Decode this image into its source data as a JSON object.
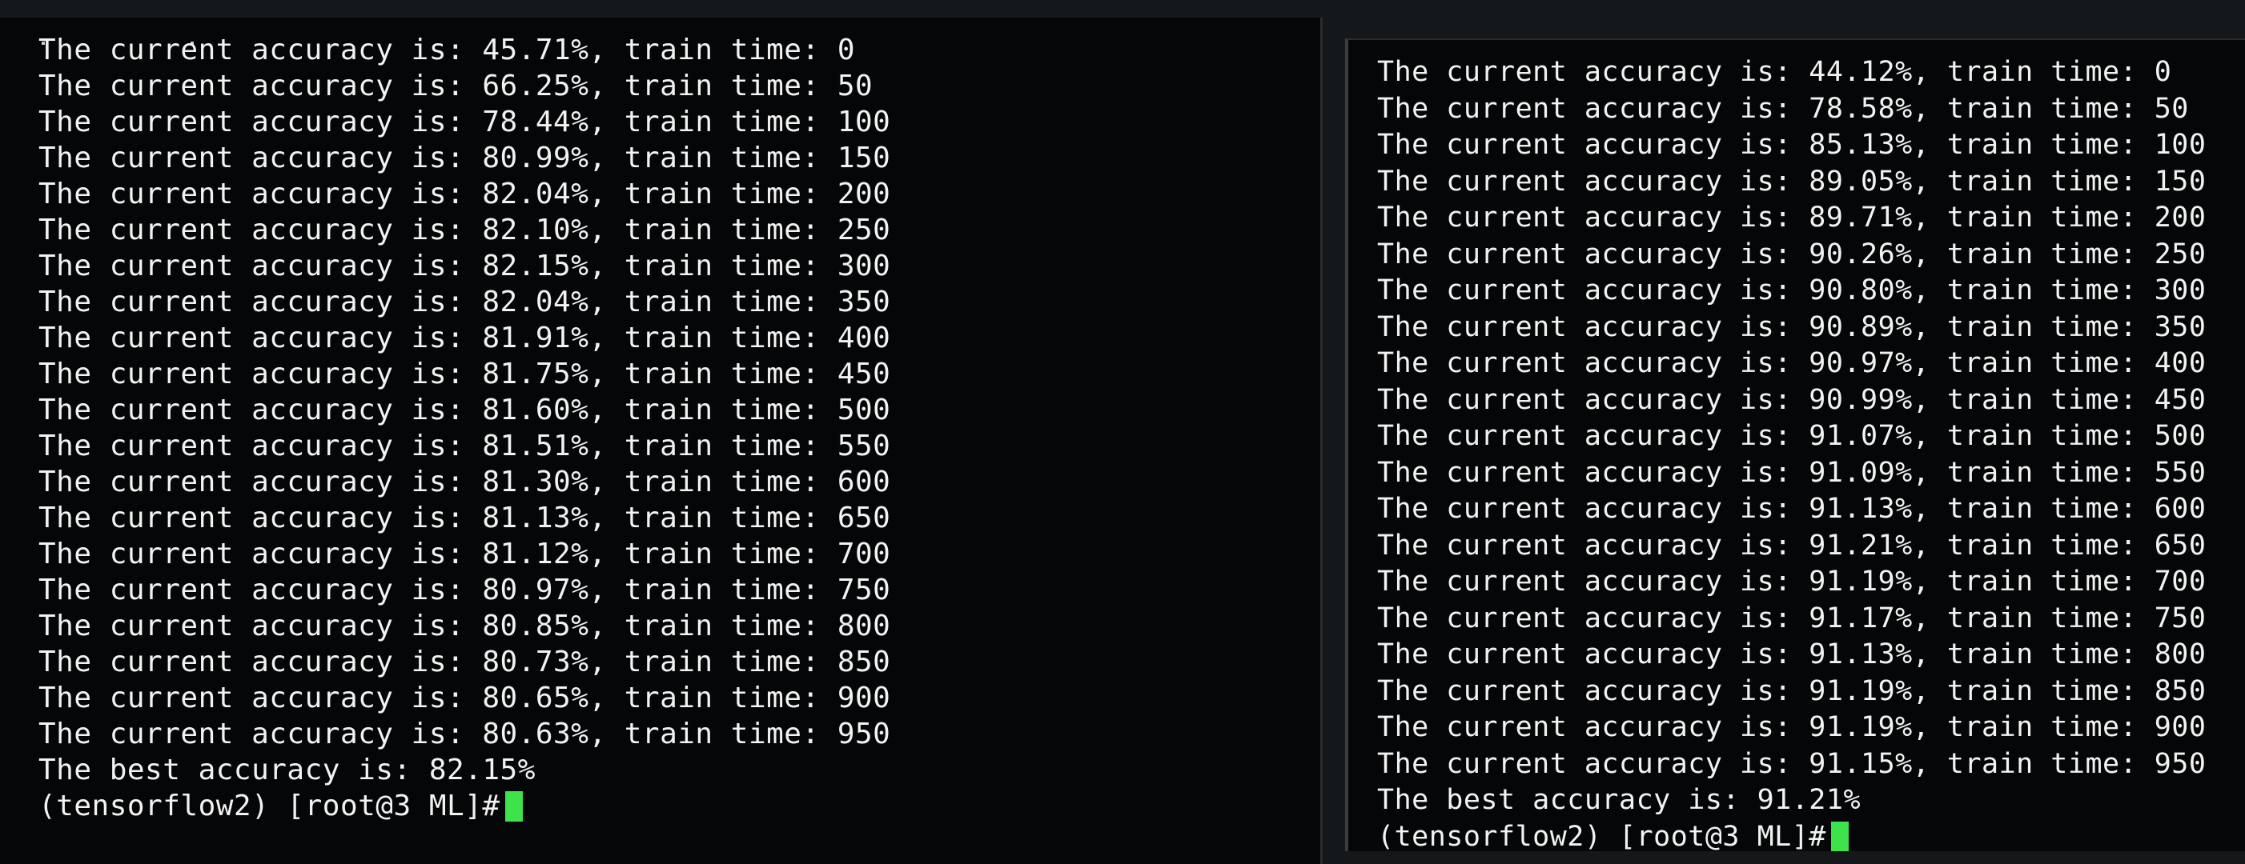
{
  "left_terminal": {
    "lines": [
      "The current accuracy is: 45.71%, train time: 0",
      "The current accuracy is: 66.25%, train time: 50",
      "The current accuracy is: 78.44%, train time: 100",
      "The current accuracy is: 80.99%, train time: 150",
      "The current accuracy is: 82.04%, train time: 200",
      "The current accuracy is: 82.10%, train time: 250",
      "The current accuracy is: 82.15%, train time: 300",
      "The current accuracy is: 82.04%, train time: 350",
      "The current accuracy is: 81.91%, train time: 400",
      "The current accuracy is: 81.75%, train time: 450",
      "The current accuracy is: 81.60%, train time: 500",
      "The current accuracy is: 81.51%, train time: 550",
      "The current accuracy is: 81.30%, train time: 600",
      "The current accuracy is: 81.13%, train time: 650",
      "The current accuracy is: 81.12%, train time: 700",
      "The current accuracy is: 80.97%, train time: 750",
      "The current accuracy is: 80.85%, train time: 800",
      "The current accuracy is: 80.73%, train time: 850",
      "The current accuracy is: 80.65%, train time: 900",
      "The current accuracy is: 80.63%, train time: 950",
      "The best accuracy is: 82.15%"
    ],
    "prompt": "(tensorflow2) [root@3 ML]#"
  },
  "right_terminal": {
    "lines": [
      "The current accuracy is: 44.12%, train time: 0",
      "The current accuracy is: 78.58%, train time: 50",
      "The current accuracy is: 85.13%, train time: 100",
      "The current accuracy is: 89.05%, train time: 150",
      "The current accuracy is: 89.71%, train time: 200",
      "The current accuracy is: 90.26%, train time: 250",
      "The current accuracy is: 90.80%, train time: 300",
      "The current accuracy is: 90.89%, train time: 350",
      "The current accuracy is: 90.97%, train time: 400",
      "The current accuracy is: 90.99%, train time: 450",
      "The current accuracy is: 91.07%, train time: 500",
      "The current accuracy is: 91.09%, train time: 550",
      "The current accuracy is: 91.13%, train time: 600",
      "The current accuracy is: 91.21%, train time: 650",
      "The current accuracy is: 91.19%, train time: 700",
      "The current accuracy is: 91.17%, train time: 750",
      "The current accuracy is: 91.13%, train time: 800",
      "The current accuracy is: 91.19%, train time: 850",
      "The current accuracy is: 91.19%, train time: 900",
      "The current accuracy is: 91.15%, train time: 950",
      "The best accuracy is: 91.21%"
    ],
    "prompt": "(tensorflow2) [root@3 ML]#"
  },
  "colors": {
    "text": "#f2f2f2",
    "background": "#050607",
    "cursor": "#3ee24a"
  }
}
